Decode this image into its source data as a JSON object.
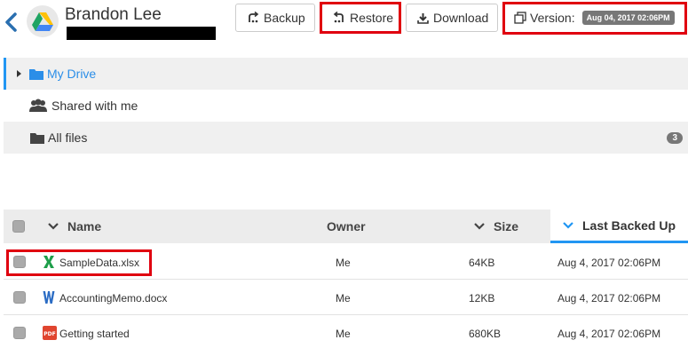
{
  "header": {
    "user_name": "Brandon Lee",
    "back_icon": "chevron-left-icon",
    "app_icon": "google-drive-icon"
  },
  "toolbar": {
    "backup_label": "Backup",
    "restore_label": "Restore",
    "download_label": "Download",
    "version_label": "Version:",
    "version_value": "Aug 04, 2017 02:06PM"
  },
  "nav": {
    "items": [
      {
        "label": "My Drive",
        "icon": "folder-icon"
      },
      {
        "label": "Shared with me",
        "icon": "users-icon"
      },
      {
        "label": "All files",
        "icon": "folder-icon",
        "count": "3"
      }
    ]
  },
  "table": {
    "columns": {
      "name": "Name",
      "owner": "Owner",
      "size": "Size",
      "last_backed_up": "Last Backed Up"
    },
    "rows": [
      {
        "name": "SampleData.xlsx",
        "icon": "excel-icon",
        "owner": "Me",
        "size": "64KB",
        "date": "Aug 4, 2017 02:06PM"
      },
      {
        "name": "AccountingMemo.docx",
        "icon": "word-icon",
        "owner": "Me",
        "size": "12KB",
        "date": "Aug 4, 2017 02:06PM"
      },
      {
        "name": "Getting started",
        "icon": "pdf-icon",
        "owner": "Me",
        "size": "680KB",
        "date": "Aug 4, 2017 02:06PM"
      }
    ]
  },
  "colors": {
    "accent": "#2196f3",
    "highlight_red": "#e0000f",
    "badge_gray": "#777777"
  }
}
